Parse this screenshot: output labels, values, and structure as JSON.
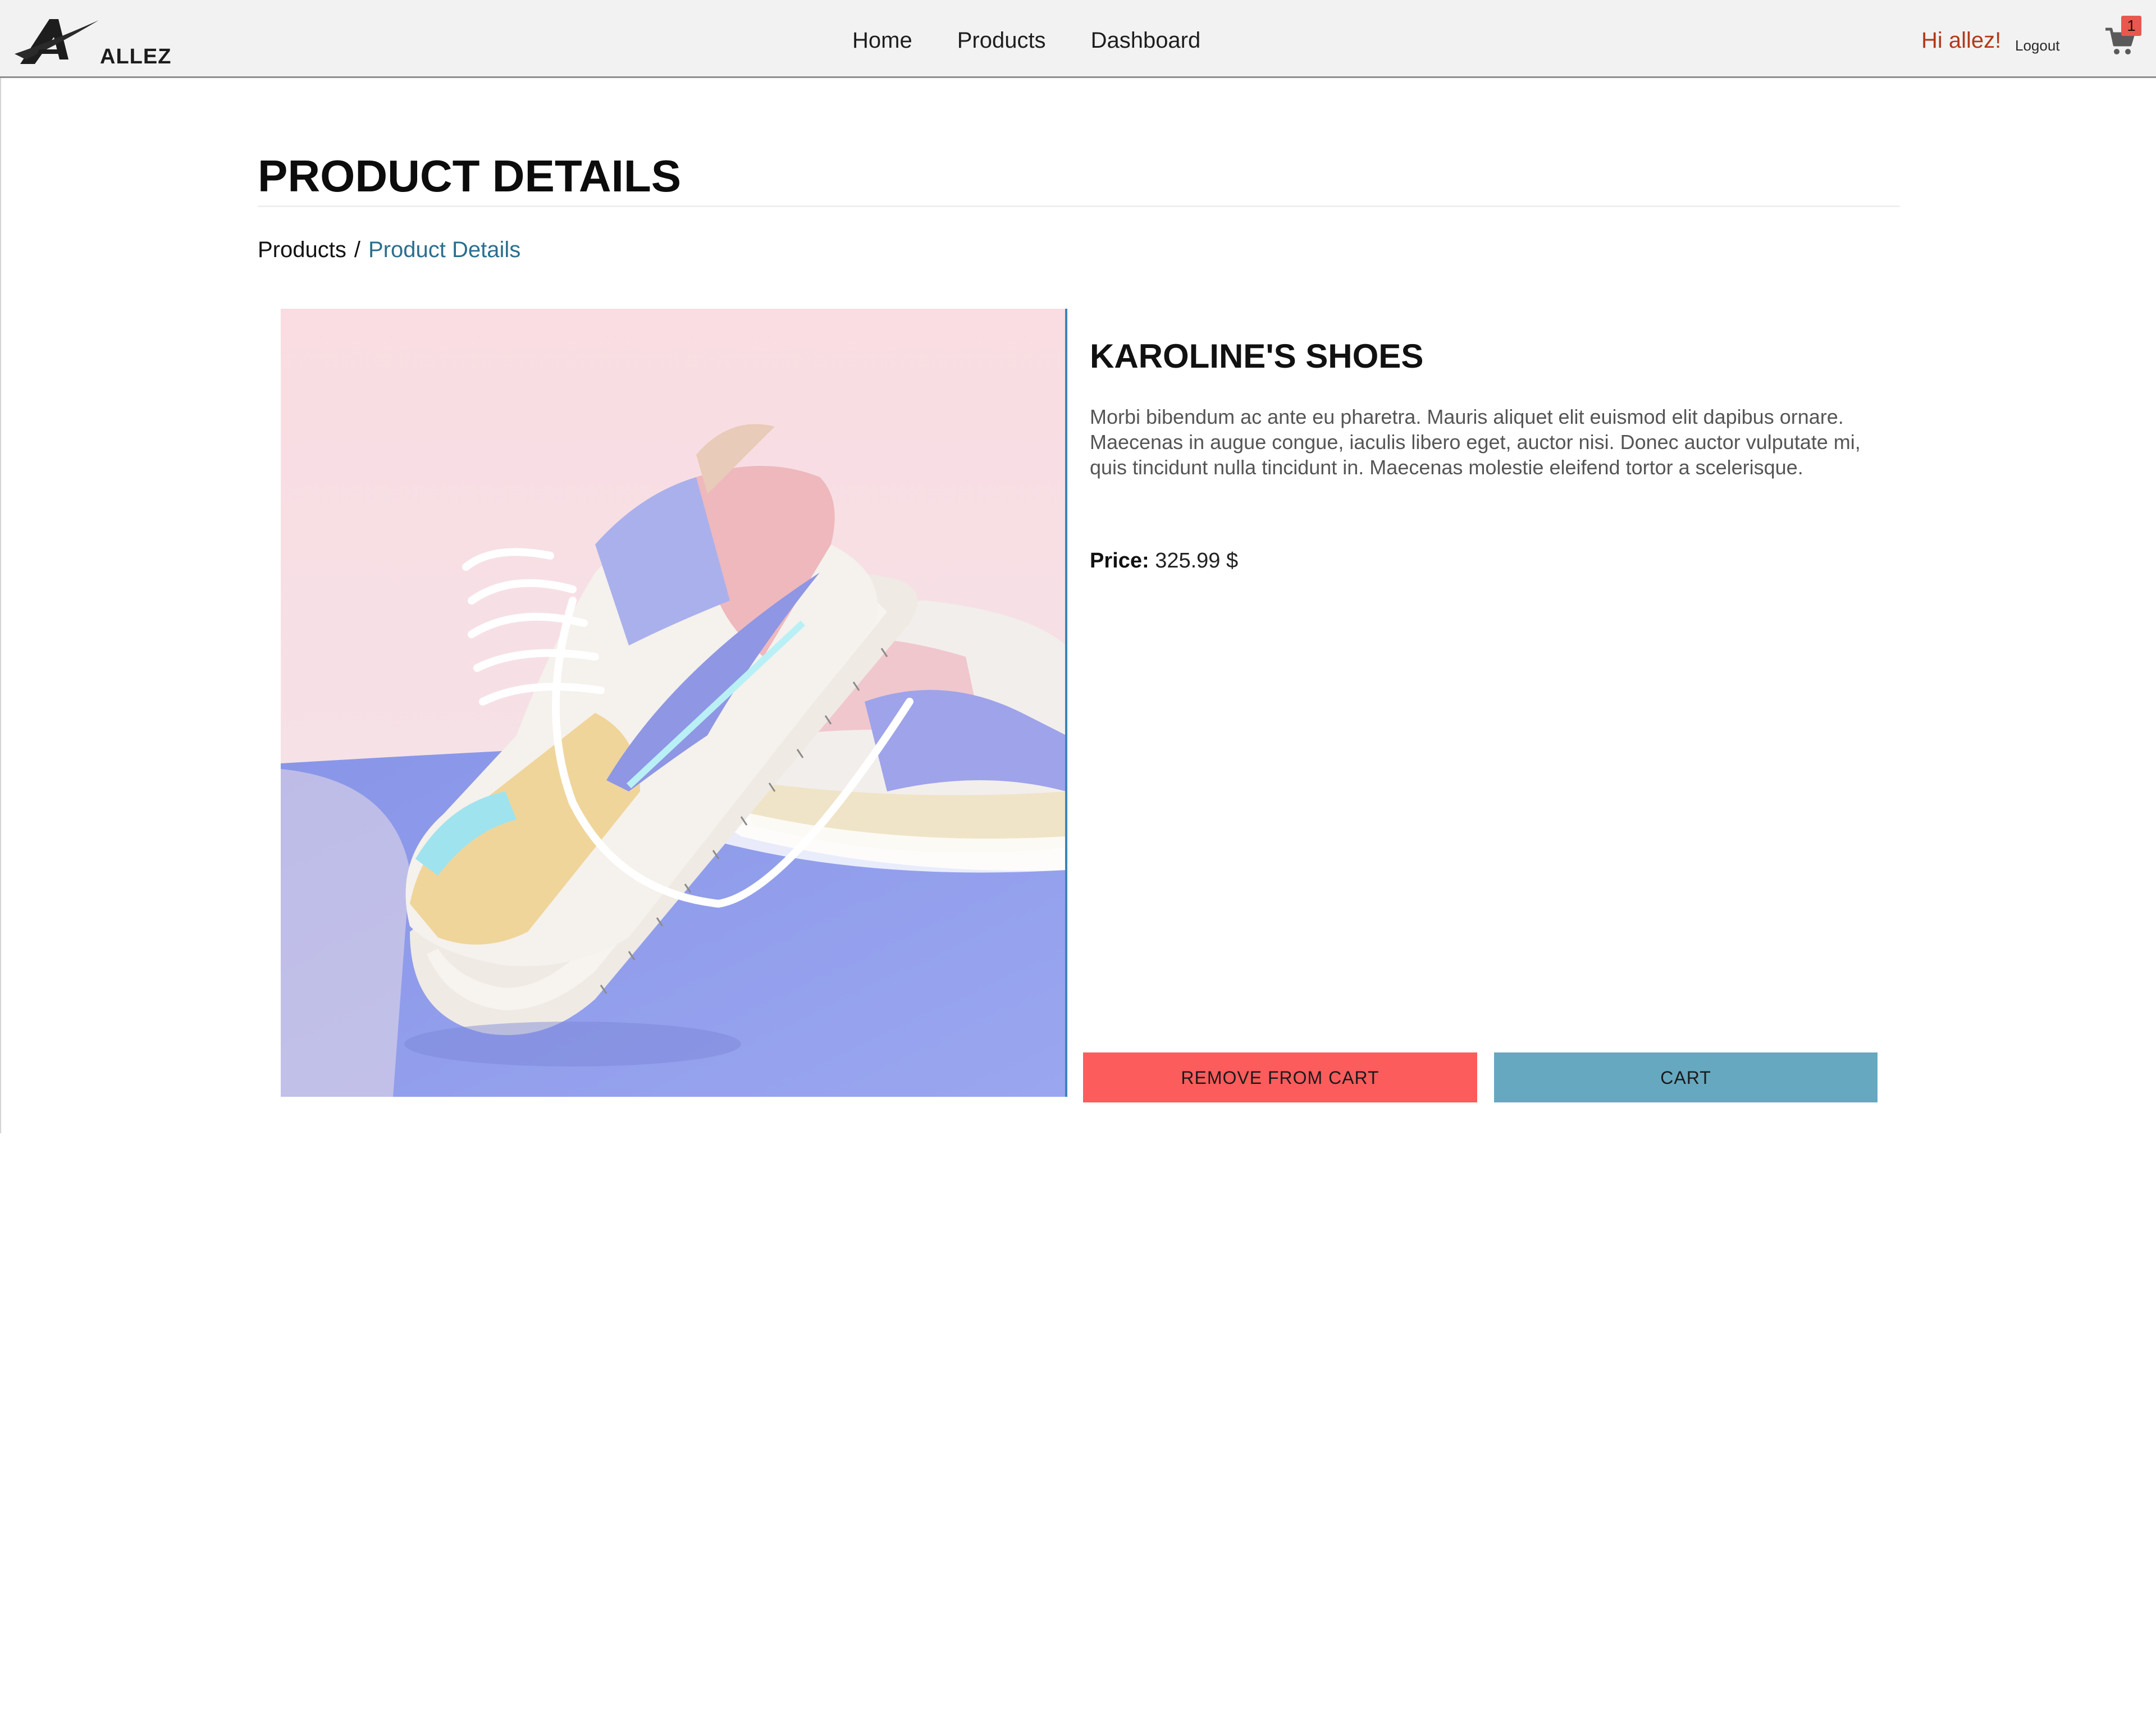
{
  "navbar": {
    "brand": "ALLEZ",
    "links": [
      "Home",
      "Products",
      "Dashboard"
    ],
    "greeting": "Hi allez!",
    "logout": "Logout",
    "cart_count": "1"
  },
  "page": {
    "title": "PRODUCT DETAILS",
    "breadcrumb": {
      "parent": "Products",
      "separator": "/",
      "current": "Product Details"
    }
  },
  "product": {
    "name": "KAROLINE'S SHOES",
    "description": "Morbi bibendum ac ante eu pharetra. Mauris aliquet elit euismod elit dapibus ornare. Maecenas in augue congue, iaculis libero eget, auctor nisi. Donec auctor vulputate mi, quis tincidunt nulla tincidunt in. Maecenas molestie eleifend tortor a scelerisque.",
    "price_label": "Price:",
    "price_value": "325.99 $",
    "image_subject": "pastel sneaker photo"
  },
  "actions": {
    "remove_label": "REMOVE FROM CART",
    "cart_label": "CART"
  },
  "colors": {
    "navbar_bg": "#f2f2f2",
    "greeting": "#b23a1a",
    "breadcrumb_active": "#2a6f8f",
    "remove_button": "#fc5c5c",
    "cart_button": "#66a8c0",
    "badge": "#e8584e"
  },
  "icons": {
    "logo": "allez-logo-icon",
    "cart": "shopping-cart-icon"
  }
}
